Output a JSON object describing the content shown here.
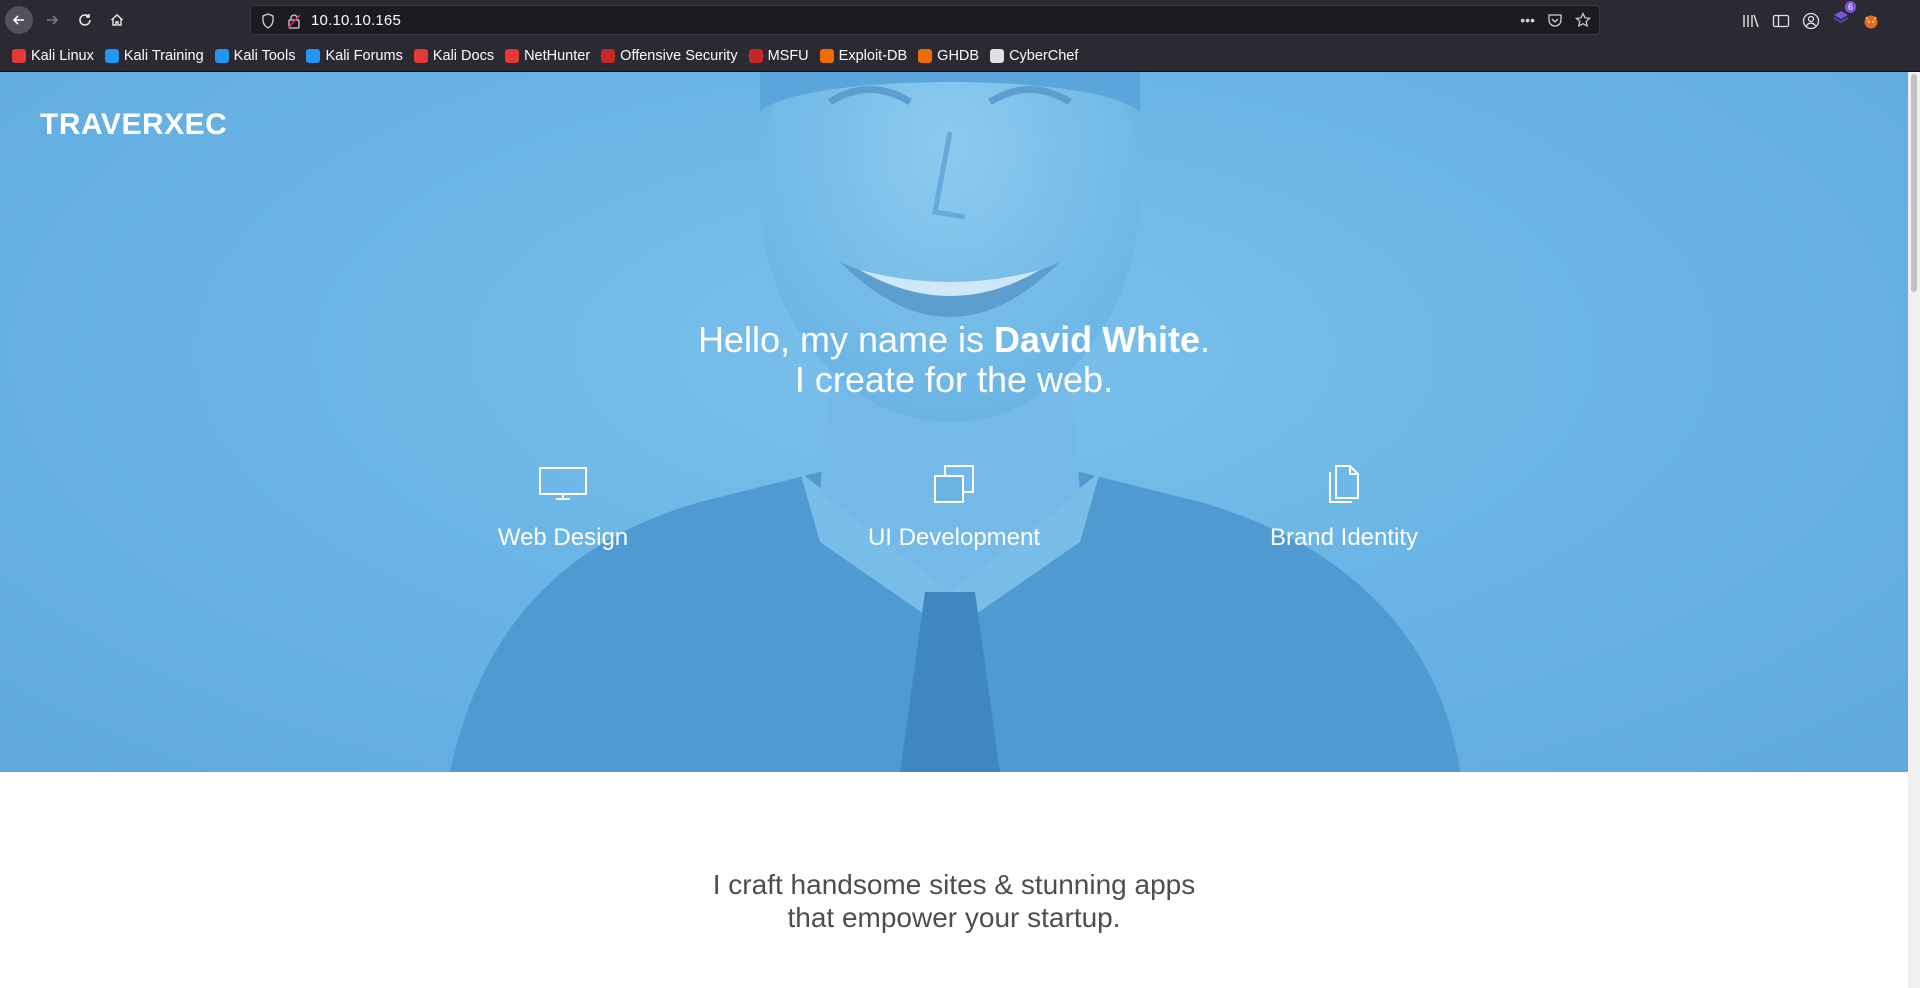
{
  "browser": {
    "url": "10.10.10.165",
    "extension_badge": "6",
    "bookmarks": [
      {
        "label": "Kali Linux",
        "color": "#e53935"
      },
      {
        "label": "Kali Training",
        "color": "#2196f3"
      },
      {
        "label": "Kali Tools",
        "color": "#2196f3"
      },
      {
        "label": "Kali Forums",
        "color": "#2196f3"
      },
      {
        "label": "Kali Docs",
        "color": "#e53935"
      },
      {
        "label": "NetHunter",
        "color": "#e53935"
      },
      {
        "label": "Offensive Security",
        "color": "#c62828"
      },
      {
        "label": "MSFU",
        "color": "#c62828"
      },
      {
        "label": "Exploit-DB",
        "color": "#ef6c00"
      },
      {
        "label": "GHDB",
        "color": "#ef6c00"
      },
      {
        "label": "CyberChef",
        "color": "#e0e0e0"
      }
    ]
  },
  "page": {
    "brand": "TRAVERXEC",
    "headline": {
      "prefix": "Hello, my name is ",
      "name": "David White",
      "suffix": ".",
      "line2": "I create for the web."
    },
    "services": [
      {
        "icon": "monitor-icon",
        "label": "Web Design"
      },
      {
        "icon": "layers-icon",
        "label": "UI Development"
      },
      {
        "icon": "documents-icon",
        "label": "Brand Identity"
      }
    ],
    "tagline": {
      "line1": "I craft handsome sites & stunning apps",
      "line2": "that empower your startup."
    },
    "colors": {
      "hero_blue": "#6bb6e6",
      "text_dark": "#4e4e4e"
    }
  }
}
